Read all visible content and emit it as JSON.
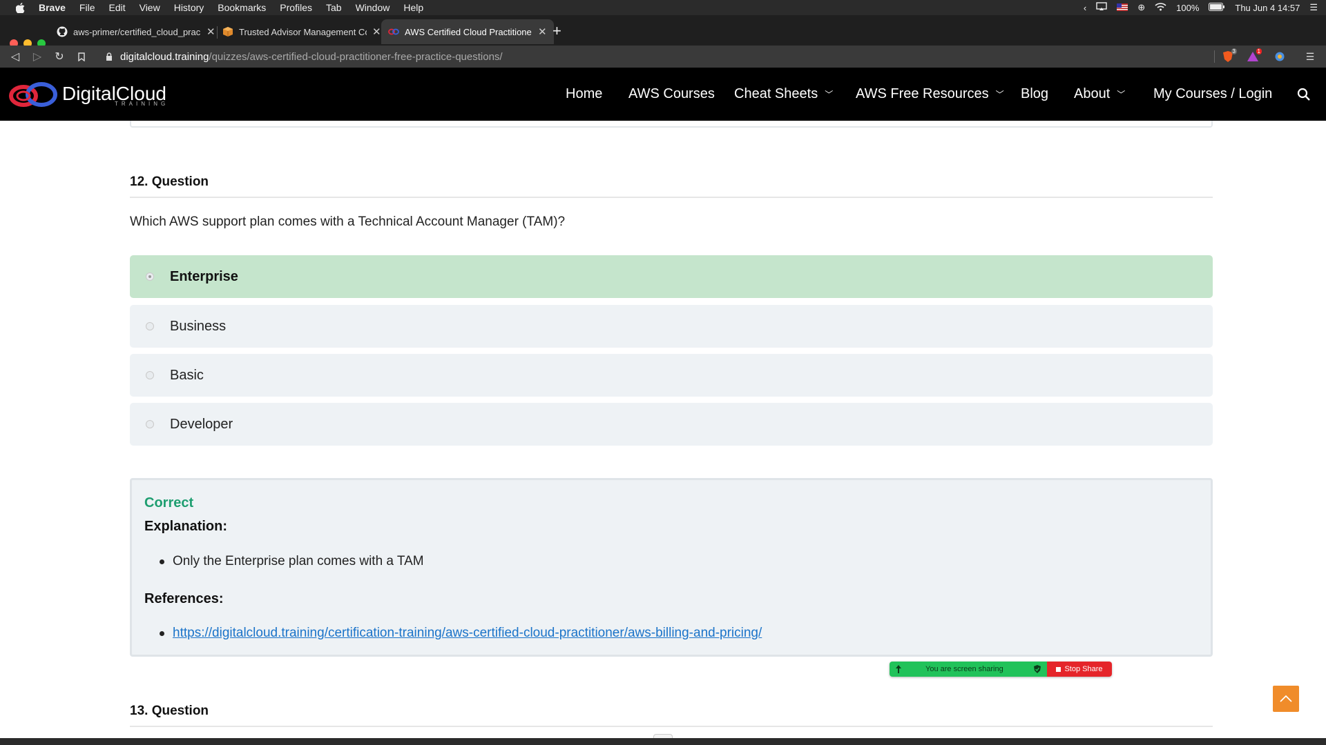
{
  "menubar": {
    "app": "Brave",
    "items": [
      "File",
      "Edit",
      "View",
      "History",
      "Bookmarks",
      "Profiles",
      "Tab",
      "Window",
      "Help"
    ],
    "battery": "100%",
    "datetime": "Thu Jun 4  14:57"
  },
  "tabs": [
    {
      "title": "aws-primer/certified_cloud_prac",
      "icon": "github-icon"
    },
    {
      "title": "Trusted Advisor Management Co",
      "icon": "aws-box-icon"
    },
    {
      "title": "AWS Certified Cloud Practitione",
      "icon": "digitalcloud-icon",
      "active": true
    }
  ],
  "address": {
    "domain": "digitalcloud.training",
    "path": "/quizzes/aws-certified-cloud-practitioner-free-practice-questions/",
    "brave_shield_count": "3",
    "rewards_count": "1"
  },
  "site": {
    "logo_text": "DigitalCloud",
    "logo_sub": "TRAINING",
    "nav": [
      {
        "label": "Home",
        "dropdown": false
      },
      {
        "label": "AWS Courses",
        "dropdown": false
      },
      {
        "label": "Cheat Sheets",
        "dropdown": true
      },
      {
        "label": "AWS Free Resources",
        "dropdown": true
      },
      {
        "label": "Blog",
        "dropdown": false
      },
      {
        "label": "About",
        "dropdown": true
      },
      {
        "label": "My Courses / Login",
        "dropdown": false
      }
    ]
  },
  "question12": {
    "heading": "12. Question",
    "text": "Which AWS support plan comes with a Technical Account Manager (TAM)?",
    "answers": [
      {
        "label": "Enterprise",
        "state": "correct-selected"
      },
      {
        "label": "Business",
        "state": "unselected"
      },
      {
        "label": "Basic",
        "state": "unselected"
      },
      {
        "label": "Developer",
        "state": "unselected"
      }
    ],
    "result": {
      "status": "Correct",
      "explanation_title": "Explanation:",
      "explanation_points": [
        "Only the Enterprise plan comes with a TAM"
      ],
      "references_title": "References:",
      "references": [
        "https://digitalcloud.training/certification-training/aws-certified-cloud-practitioner/aws-billing-and-pricing/"
      ]
    }
  },
  "question13": {
    "heading": "13. Question"
  },
  "screen_share": {
    "message": "You are screen sharing",
    "stop_label": "Stop Share"
  },
  "colors": {
    "correct_bg": "#c5e5cc",
    "answer_bg": "#eef2f5",
    "correct_text": "#1e9e70",
    "link": "#1a73c9",
    "scroll_top": "#f08c2a"
  }
}
